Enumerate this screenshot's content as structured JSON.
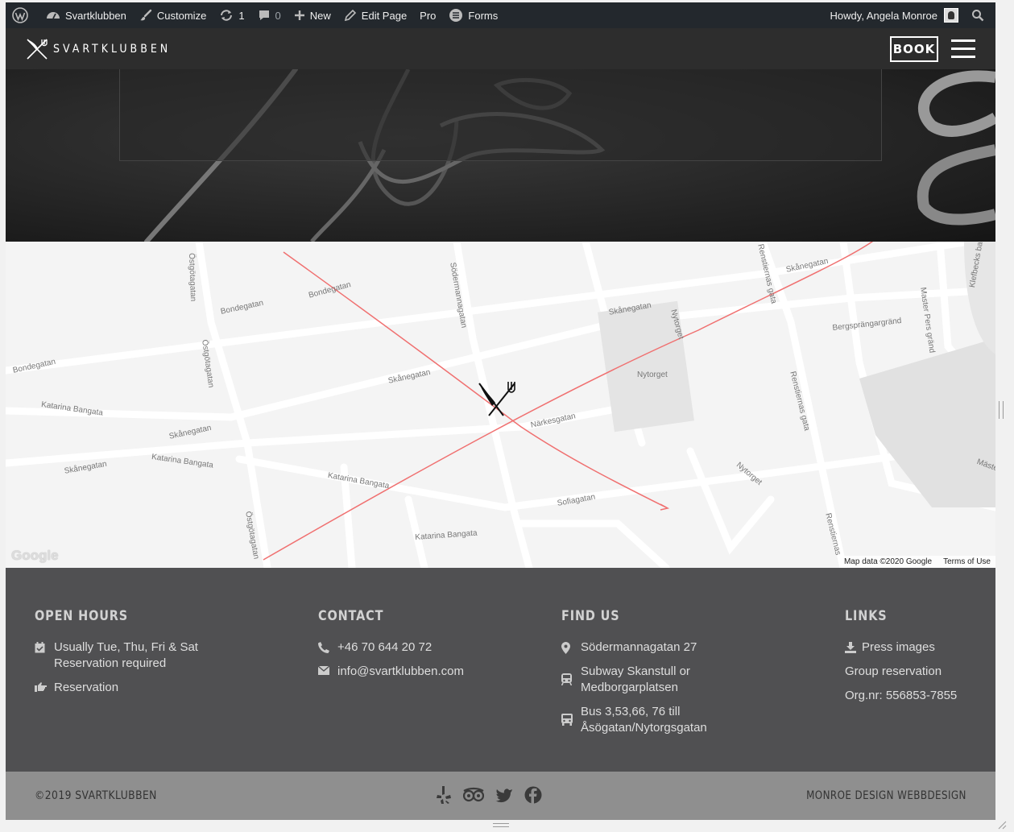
{
  "admin_bar": {
    "site_name": "Svartklubben",
    "customize": "Customize",
    "updates_count": "1",
    "comments_count": "0",
    "new": "New",
    "edit_page": "Edit Page",
    "pro": "Pro",
    "forms": "Forms",
    "howdy": "Howdy, Angela Monroe"
  },
  "header": {
    "logo_text": "SVARTKLUBBEN",
    "book_label": "BOOK"
  },
  "map": {
    "streets": [
      {
        "label": "Östgötagatan"
      },
      {
        "label": "Bondegatan"
      },
      {
        "label": "Bondegatan"
      },
      {
        "label": "Södermannagatan"
      },
      {
        "label": "Skånegatan"
      },
      {
        "label": "Renstiernas gata"
      },
      {
        "label": "Skånegatan"
      },
      {
        "label": "Master Pers gränd"
      },
      {
        "label": "Klefbecks backe"
      },
      {
        "label": "Bergsprängargränd"
      },
      {
        "label": "Nytorget"
      },
      {
        "label": "Bondegatan"
      },
      {
        "label": "Östgötagatan"
      },
      {
        "label": "Skånegatan"
      },
      {
        "label": "Nytorget"
      },
      {
        "label": "Katarina Bangata"
      },
      {
        "label": "Skånegatan"
      },
      {
        "label": "Närkesgatan"
      },
      {
        "label": "Renstiernas gata"
      },
      {
        "label": "Skånegatan"
      },
      {
        "label": "Katarina Bangata"
      },
      {
        "label": "Nytorget"
      },
      {
        "label": "Katarina Bangata"
      },
      {
        "label": "Sofiagatan"
      },
      {
        "label": "Östgötagatan"
      },
      {
        "label": "Katarina Bangata"
      },
      {
        "label": "Renstiernas"
      },
      {
        "label": "Östgötagatan"
      },
      {
        "label": "Mäste"
      }
    ],
    "google_mark": "Google",
    "attribution": "Map data ©2020 Google",
    "terms": "Terms of Use"
  },
  "footer": {
    "open_hours": {
      "title": "OPEN HOURS",
      "days": "Usually Tue, Thu, Fri & Sat",
      "note": "Reservation required",
      "reservation": "Reservation"
    },
    "contact": {
      "title": "CONTACT",
      "phone": "+46 70 644 20 72",
      "email": "info@svartklubben.com"
    },
    "find_us": {
      "title": "FIND US",
      "address": "Södermannagatan 27",
      "subway_1": "Subway Skanstull or",
      "subway_2": "Medborgarplatsen",
      "bus_1": "Bus 3,53,66, 76 till",
      "bus_2": "Åsögatan/Nytorgsgatan"
    },
    "links": {
      "title": "LINKS",
      "press": "Press images",
      "group": "Group reservation",
      "org": "Org.nr: 556853-7855"
    }
  },
  "bottom_bar": {
    "copyright": "©2019 SVARTKLUBBEN",
    "credit": "MONROE DESIGN WEBBDESIGN"
  },
  "colors": {
    "admin_bar": "#23282d",
    "header": "#2d2d2d",
    "footer": "#505052",
    "bottom_bar": "#8f8f8f",
    "map_line": "#f07070"
  }
}
